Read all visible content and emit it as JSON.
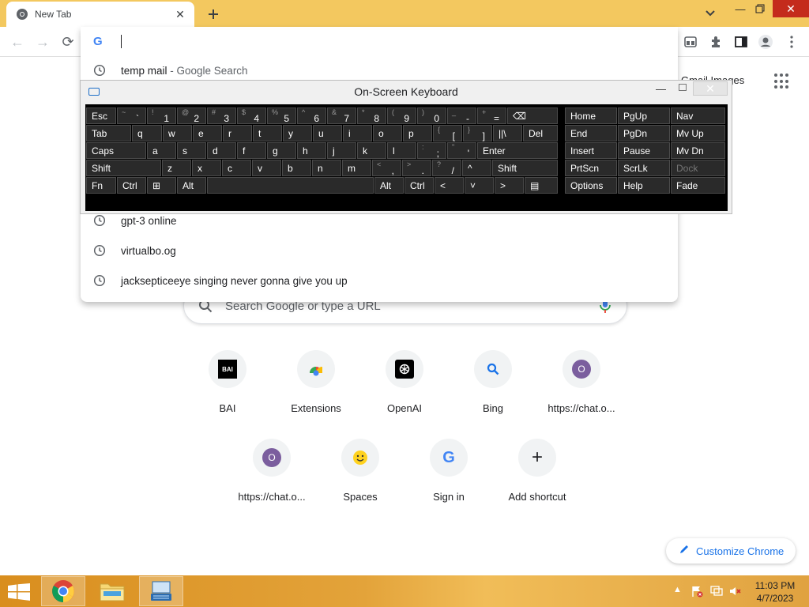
{
  "tab": {
    "title": "New Tab",
    "close": "✕"
  },
  "window": {
    "min": "—",
    "close": "✕"
  },
  "toolbar": {
    "back": "←",
    "forward": "→",
    "reload": "⟳"
  },
  "omnibox": {
    "suggestions": [
      {
        "text": "temp mail",
        "sub": " - Google Search"
      },
      {
        "text": "gpt-3 online",
        "sub": ""
      },
      {
        "text": "virtualbo.og",
        "sub": ""
      },
      {
        "text": "jacksepticeeye singing never gonna give you up",
        "sub": ""
      }
    ]
  },
  "ntp": {
    "top_link": "Gmail  Images",
    "search_placeholder": "Search Google or type a URL",
    "shortcuts": [
      {
        "label": "BAI",
        "badge": "BAI"
      },
      {
        "label": "Extensions",
        "badge": ""
      },
      {
        "label": "OpenAI",
        "badge": ""
      },
      {
        "label": "Bing",
        "badge": ""
      },
      {
        "label": "https://chat.o...",
        "badge": "O"
      },
      {
        "label": "https://chat.o...",
        "badge": "O"
      },
      {
        "label": "Spaces",
        "badge": ""
      },
      {
        "label": "Sign in",
        "badge": "G"
      },
      {
        "label": "Add shortcut",
        "badge": "+"
      }
    ],
    "customize": "Customize Chrome"
  },
  "keyboard": {
    "title": "On-Screen Keyboard",
    "min": "—",
    "close": "✕",
    "rows": [
      [
        "Esc",
        "~|`",
        "!|1",
        "@|2",
        "#|3",
        "$|4",
        "%|5",
        "^|6",
        "&|7",
        "*|8",
        "(|9",
        ")|0",
        "_|-",
        "+|=",
        "⌫",
        "Home",
        "PgUp",
        "Nav"
      ],
      [
        "Tab",
        "q",
        "w",
        "e",
        "r",
        "t",
        "y",
        "u",
        "i",
        "o",
        "p",
        "{|[",
        "}|]",
        "||\\",
        "Del",
        "End",
        "PgDn",
        "Mv Up"
      ],
      [
        "Caps",
        "a",
        "s",
        "d",
        "f",
        "g",
        "h",
        "j",
        "k",
        "l",
        ":|;",
        "\"|'",
        "Enter",
        "Insert",
        "Pause",
        "Mv Dn"
      ],
      [
        "Shift",
        "z",
        "x",
        "c",
        "v",
        "b",
        "n",
        "m",
        "<|,",
        ">|.",
        "?|/",
        "^",
        "Shift",
        "PrtScn",
        "ScrLk",
        "Dock"
      ],
      [
        "Fn",
        "Ctrl",
        "⊞",
        "Alt",
        "",
        "Alt",
        "Ctrl",
        "<",
        "˅",
        ">",
        "▤",
        "Options",
        "Help",
        "Fade"
      ]
    ]
  },
  "taskbar": {
    "time": "11:03 PM",
    "date": "4/7/2023",
    "tray_up": "▲"
  }
}
